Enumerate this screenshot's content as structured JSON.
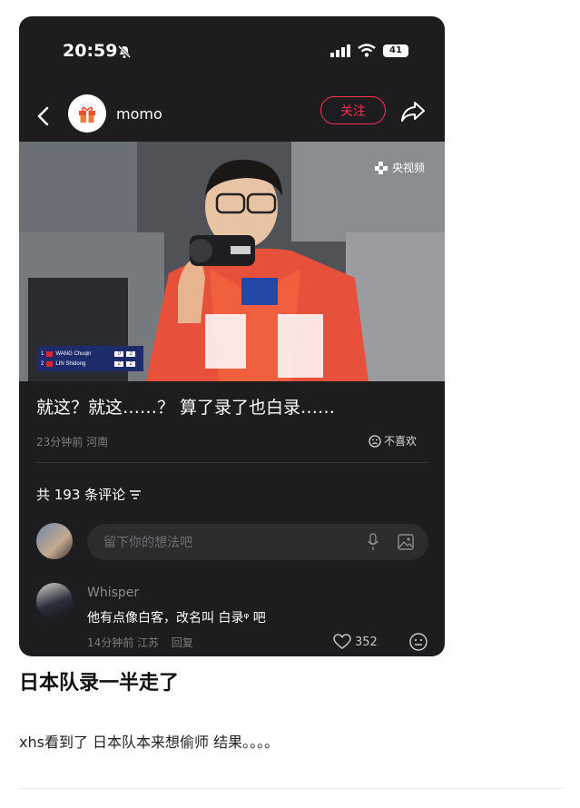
{
  "status_bar": {
    "time": "20:59",
    "battery": "41"
  },
  "nav": {
    "username": "momo",
    "follow_label": "关注"
  },
  "video": {
    "watermark": "央视频",
    "scoreboard": [
      {
        "seed": "1",
        "name": "WANG Chuqin",
        "sets": "0",
        "points": "2"
      },
      {
        "seed": "2",
        "name": "LIN Shidong",
        "sets": "2",
        "points": "2"
      }
    ]
  },
  "post": {
    "caption": "就这？就这……？ 算了录了也白录……",
    "time_location": "23分钟前 河南",
    "dislike_label": "不喜欢"
  },
  "comments": {
    "count_label": "共 193 条评论",
    "input_placeholder": "留下你的想法吧",
    "items": [
      {
        "user": "Whisper",
        "text": "他有点像白客，改名叫 白录ᵠ 吧",
        "meta": "14分钟前 江苏",
        "reply_label": "回复",
        "likes": "352"
      }
    ]
  },
  "article": {
    "title": "日本队录一半走了",
    "body": "xhs看到了 日本队本来想偷师 结果。。。。"
  },
  "colors": {
    "accent": "#ff2d55",
    "panel": "#1d1d1f"
  }
}
